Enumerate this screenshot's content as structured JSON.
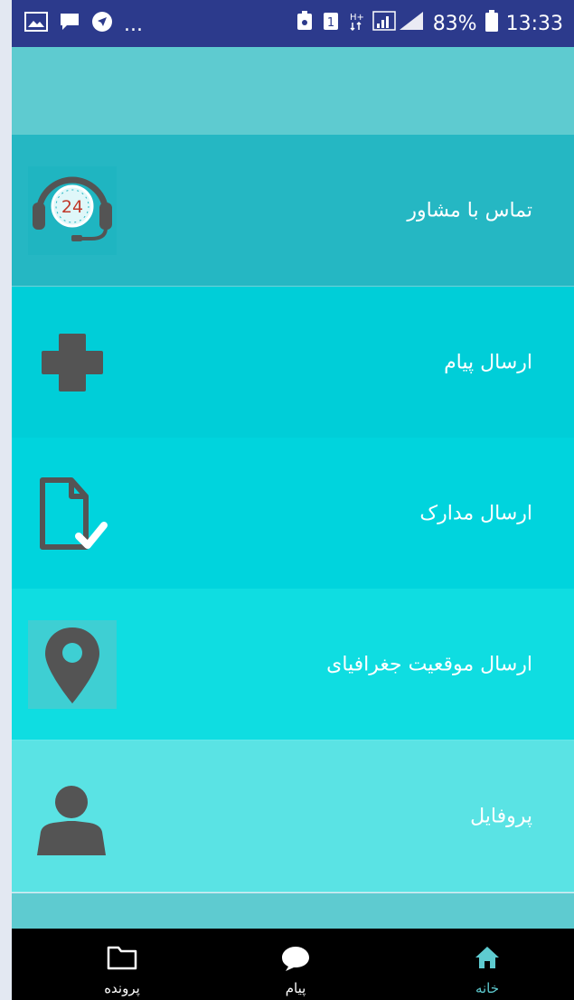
{
  "status_bar": {
    "notification_icons": [
      "gallery-icon",
      "chat-bubble-icon",
      "navigation-icon"
    ],
    "overflow": "...",
    "right_icons": [
      "lock-battery-icon",
      "sim-1-icon",
      "hplus-icon",
      "signal-icon"
    ],
    "battery_percent": "83%",
    "time": "13:33"
  },
  "menu": {
    "items": [
      {
        "label": "تماس با مشاور",
        "icon": "headset-24-icon",
        "bg": "#25b7c3"
      },
      {
        "label": "ارسال پیام",
        "icon": "medical-cross-icon",
        "bg": "#00ced8"
      },
      {
        "label": "ارسال مدارک",
        "icon": "document-check-icon",
        "bg": "#00d4dd"
      },
      {
        "label": "ارسال موقعیت جغرافیای",
        "icon": "location-pin-icon",
        "bg": "#0fdde1"
      },
      {
        "label": "پروفایل",
        "icon": "user-profile-icon",
        "bg": "#5ae3e4"
      }
    ]
  },
  "headset_badge": "24",
  "bottom_nav": {
    "items": [
      {
        "label": "پرونده",
        "icon": "folder-icon",
        "active": false
      },
      {
        "label": "پیام",
        "icon": "chat-icon",
        "active": false
      },
      {
        "label": "خانه",
        "icon": "home-icon",
        "active": true
      }
    ]
  },
  "colors": {
    "status_bar": "#2c3a8c",
    "app_bar": "#5ecbd0",
    "icon_gray": "#545454",
    "nav_active": "#5ecbd0",
    "nav_inactive": "#ffffff"
  }
}
